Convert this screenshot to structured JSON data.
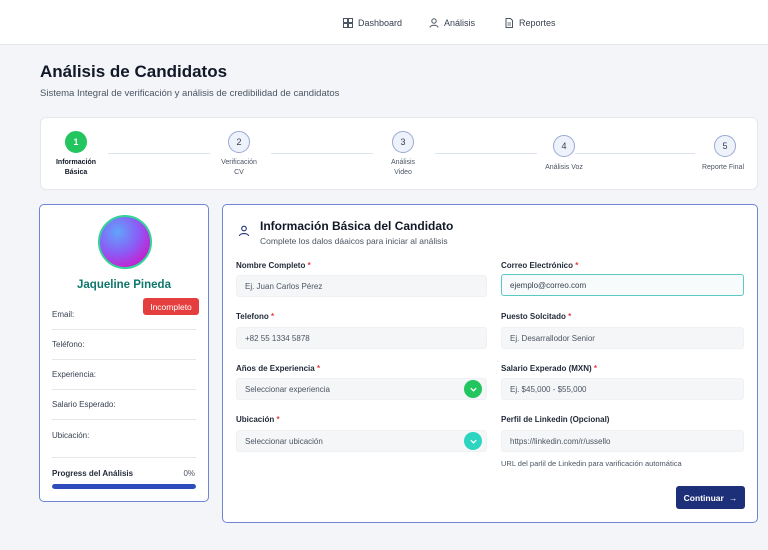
{
  "nav": [
    {
      "label": "Dashboard",
      "icon": "dashboard-icon"
    },
    {
      "label": "Análisis",
      "icon": "user-icon"
    },
    {
      "label": "Reportes",
      "icon": "document-icon"
    }
  ],
  "header": {
    "title": "Análisis de Candidatos",
    "subtitle": "Sistema Integral de verificación y análisis de credibilidad de candidatos"
  },
  "stepper": {
    "steps": [
      {
        "number": "1",
        "label_line1": "Información",
        "label_line2": "Básica",
        "active": true
      },
      {
        "number": "2",
        "label_line1": "Verificación",
        "label_line2": "CV",
        "active": false
      },
      {
        "number": "3",
        "label_line1": "Análisis",
        "label_line2": "Video",
        "active": false
      },
      {
        "number": "4",
        "label_line1": "Análisis Voz",
        "label_line2": "",
        "active": false
      },
      {
        "number": "5",
        "label_line1": "Reporte Final",
        "label_line2": "",
        "active": false
      }
    ]
  },
  "profile": {
    "name": "Jaqueline Pineda",
    "status_badge": "Incompleto",
    "rows": [
      "Email:",
      "Teléfono:",
      "Experiencia:",
      "Salario Esperado:",
      "Ubicación:"
    ],
    "progress_label": "Progress del Análisis",
    "progress_value": "0%",
    "progress_fraction": 1.0
  },
  "form": {
    "title": "Información Básica del Candidato",
    "subtitle": "Complete los dalos dáaicos para iniciar al análisis",
    "fields": {
      "nombre": {
        "label": "Nombre Completo",
        "placeholder": "Ej. Juan Carlos Pérez"
      },
      "correo": {
        "label": "Correo Electrónico",
        "value": "ejemplo@correo.com"
      },
      "telefono": {
        "label": "Telefono",
        "value": "+82 55 1334 5878"
      },
      "puesto": {
        "label": "Puesto Solcitado",
        "placeholder": "Ej. Desarrallodor Senior"
      },
      "experiencia": {
        "label": "Años de Experiencia",
        "placeholder": "Seleccionar experiencia"
      },
      "salario": {
        "label": "Salario Experado (MXN)",
        "placeholder": "Ej. $45,000 - $55,000"
      },
      "ubicacion": {
        "label": "Ubicación",
        "placeholder": "Seleccionar ubicación"
      },
      "linkedin": {
        "label": "Perfil de Linkedin (Opcional)",
        "value": "https://linkedin.com/r/ussello",
        "helper": "URL del parlil de Linkedin para varificación automática"
      }
    },
    "required_mark": "*",
    "continue_label": "Continuar",
    "arrow": "→"
  },
  "colors": {
    "primary": "#1e2f7a",
    "success": "#22c55e",
    "danger": "#e53e3e",
    "teal": "#2dd4bf"
  }
}
